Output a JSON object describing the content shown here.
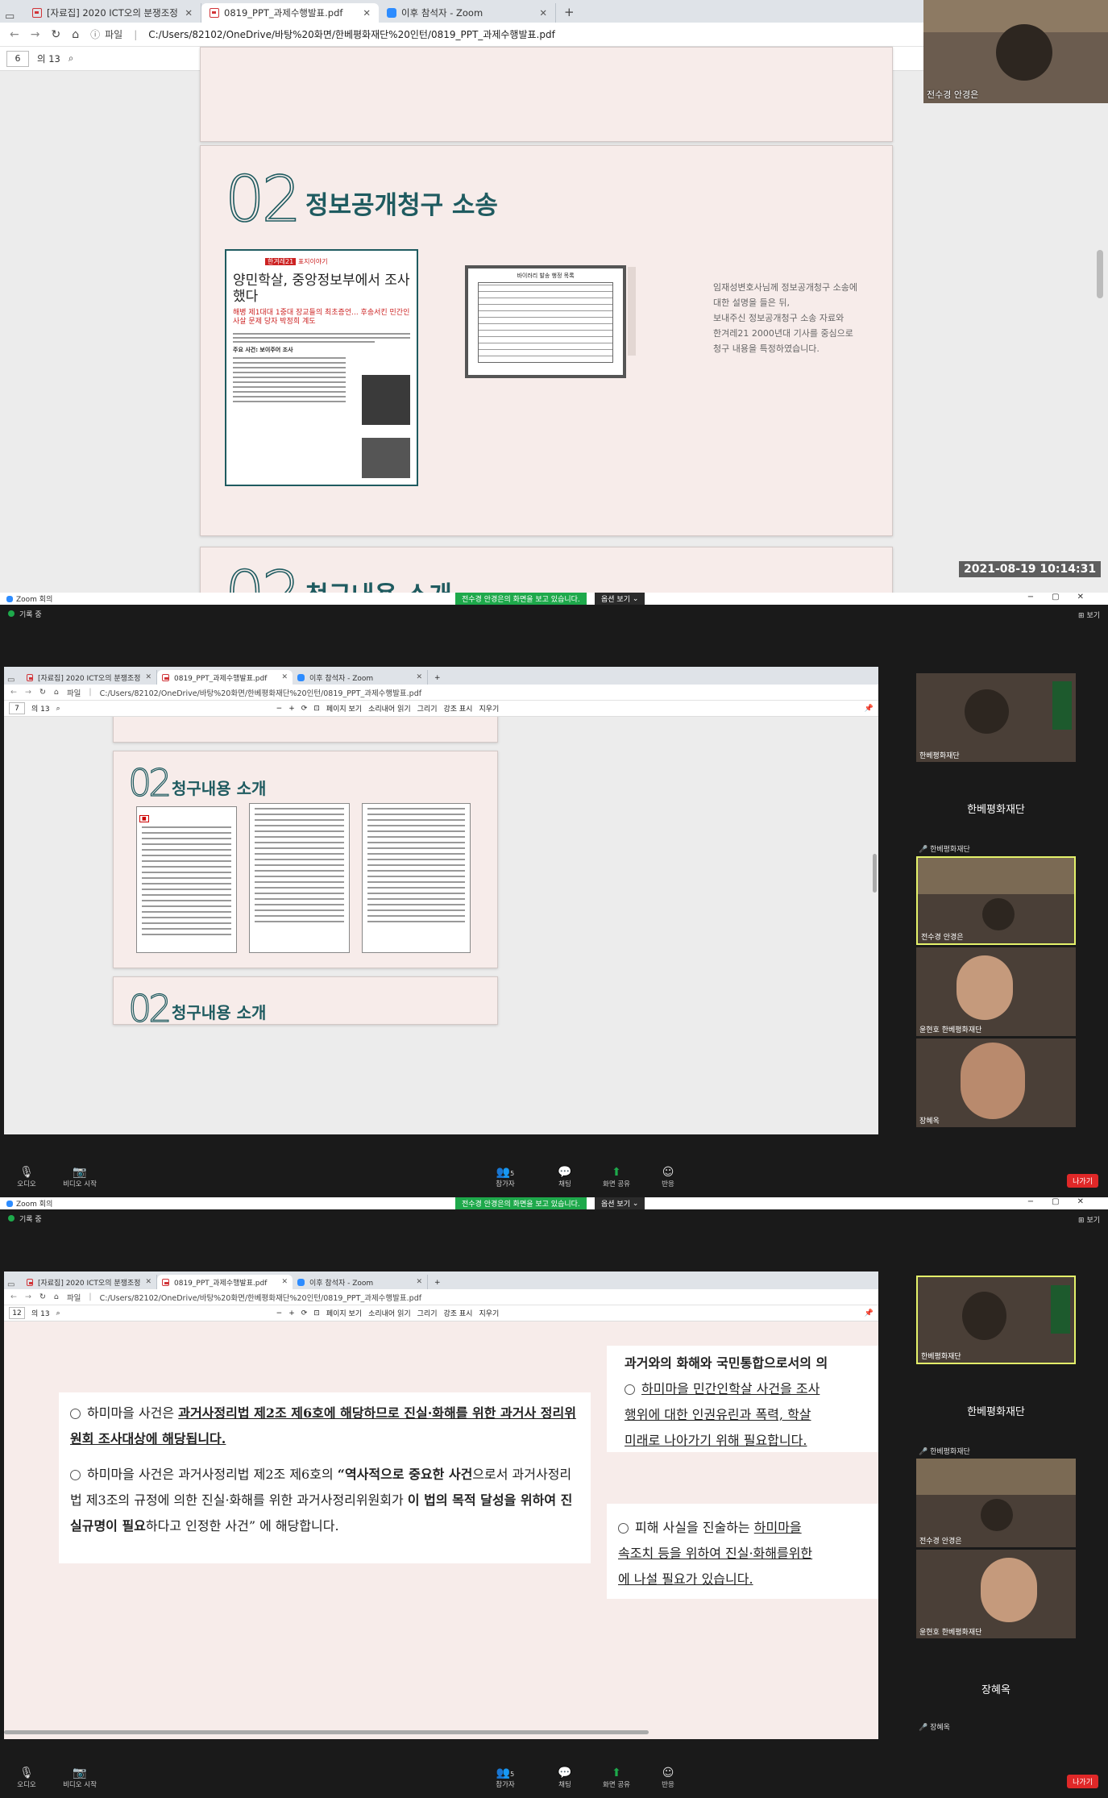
{
  "p1": {
    "tabs": [
      {
        "label": "[자료집] 2020 ICT오의 분쟁조정"
      },
      {
        "label": "0819_PPT_과제수행발표.pdf"
      },
      {
        "label": "이후 참석자 - Zoom"
      }
    ],
    "file_label": "파일",
    "url": "C:/Users/82102/OneDrive/바탕%20화면/한베평화재단%20인턴/0819_PPT_과제수행발표.pdf",
    "page_current": "6",
    "page_total": "의 13",
    "toolbar": {
      "page_view": "페이지 보기",
      "read_aloud": "소리내어 읽기",
      "draw": "그리기",
      "highlight": "강조 표시"
    },
    "slide_num": "02",
    "slide_title": "정보공개청구 소송",
    "article": {
      "tag": "한겨레21",
      "section": "표지이야기",
      "headline": "양민학살, 중앙정보부에서 조사했다",
      "sub": "해병 제1대대 1중대 장교들의 최초증언... 후송서킨 민간인 사살 문제 당자 박정희 계도",
      "body_label": "주요 사건: 보이주어 조사"
    },
    "scan_title": "바이러리 발송 행정 목록",
    "caption_lines": [
      "임재성변호사님께 정보공개청구 소송에",
      "대한 설명을 들은 뒤,",
      "보내주신 정보공개청구 소송 자료와",
      "한겨레21 2000년대 기사를 중심으로",
      "청구 내용을 특정하였습니다."
    ],
    "next_title": "청구내용 소개",
    "timestamp": "2021-08-19  10:14:31",
    "cam_name": "전수경 안경은"
  },
  "z": {
    "window_title": "Zoom 회의",
    "share_banner": "전수경 안경은의 화면을 보고 있습니다.",
    "view_options": "옵션 보기",
    "recording": "기록 중",
    "view": "보기",
    "audio": "오디오",
    "video": "비디오 시작",
    "participants": "참가자",
    "participants_count": "5",
    "chat": "채팅",
    "share": "화면 공유",
    "reactions": "반응",
    "leave": "나가기"
  },
  "p2": {
    "page_current": "7",
    "page_total": "의 13",
    "slide_num": "02",
    "slide_title": "청구내용 소개",
    "next_title": "청구내용 소개",
    "erase": "지우기",
    "side": {
      "v1_name": "한베평화재단",
      "big_name": "한베평화재단",
      "sub_name": "한베평화재단",
      "v2_name": "전수경 안경은",
      "v3_name": "윤현호 한베평화재단",
      "v4_name": "장혜옥"
    }
  },
  "p3": {
    "page_current": "12",
    "page_total": "의 13",
    "left_box": {
      "p1_a": "하미마을 사건은 ",
      "p1_b": "과거사정리법 제2조 제6호에 해당하므로 진실·화해를 위한 과거사 정리위원회 조사대상에 해당됩니다.",
      "p2_a": "하미마을 사건은 과거사정리법 제2조 제6호의 ",
      "p2_b": "“역사적으로 중요한 사건",
      "p2_c": "으로서 과거사정리법 제3조의 규정에 의한 진실·화해를 위한 과거사정리위원회가 ",
      "p2_d": "이 법의 목적 달성을 위하여 진실규명이 필요",
      "p2_e": "하다고 인정한 사건” 에 해당합니다."
    },
    "right_top": {
      "line1": "과거와의 화해와 국민통합으로서의 의",
      "line2": "하미마을 민간인학살 사건을 조사",
      "line3": "행위에 대한 인권유린과 폭력, 학살 ",
      "line4": "미래로 나아가기 위해 필요합니다."
    },
    "right_bottom": {
      "line1a": "피해 사실을 진술하는 ",
      "line1b": "하미마을 ",
      "line2": "속조치 등을 위하여 진실·화해를위한",
      "line3": "에 나설 필요가 있습니다."
    },
    "side": {
      "v1_name": "한베평화재단",
      "big_name": "한베평화재단",
      "sub_name": "한베평화재단",
      "v2_name": "전수경 안경은",
      "v3_name": "윤현호 한베평화재단",
      "big2_name": "장혜옥",
      "sub2_name": "장혜옥"
    }
  }
}
